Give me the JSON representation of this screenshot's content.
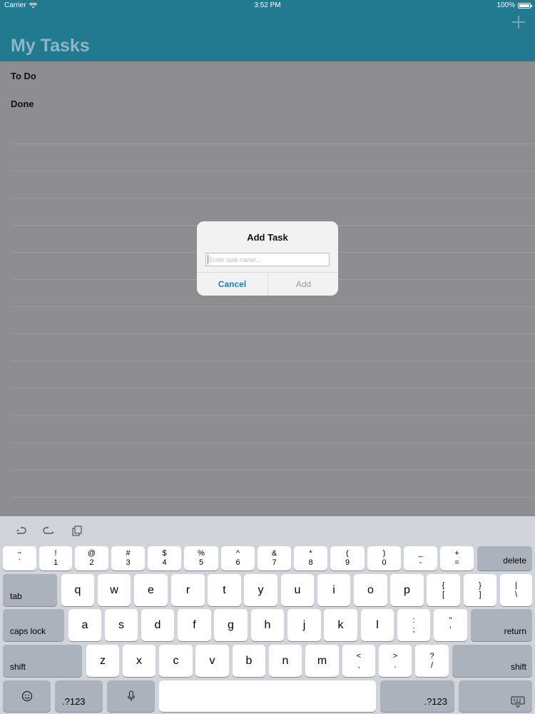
{
  "status_bar": {
    "carrier": "Carrier",
    "time": "3:52 PM",
    "battery": "100%"
  },
  "nav": {
    "title": "My Tasks",
    "add_icon": "plus-icon"
  },
  "sections": {
    "todo": "To Do",
    "done": "Done"
  },
  "alert": {
    "title": "Add Task",
    "placeholder": "Enter task name...",
    "cancel": "Cancel",
    "add": "Add"
  },
  "keyboard": {
    "toolbar": [
      "undo-icon",
      "redo-icon",
      "paste-icon"
    ],
    "row1": [
      {
        "top": "~",
        "bottom": "`"
      },
      {
        "top": "!",
        "bottom": "1"
      },
      {
        "top": "@",
        "bottom": "2"
      },
      {
        "top": "#",
        "bottom": "3"
      },
      {
        "top": "$",
        "bottom": "4"
      },
      {
        "top": "%",
        "bottom": "5"
      },
      {
        "top": "^",
        "bottom": "6"
      },
      {
        "top": "&",
        "bottom": "7"
      },
      {
        "top": "*",
        "bottom": "8"
      },
      {
        "top": "(",
        "bottom": "9"
      },
      {
        "top": ")",
        "bottom": "0"
      },
      {
        "top": "_",
        "bottom": "-"
      },
      {
        "top": "+",
        "bottom": "="
      }
    ],
    "delete": "delete",
    "tab": "tab",
    "row2": [
      "q",
      "w",
      "e",
      "r",
      "t",
      "y",
      "u",
      "i",
      "o",
      "p"
    ],
    "row2_symbols": [
      {
        "top": "{",
        "bottom": "["
      },
      {
        "top": "}",
        "bottom": "]"
      },
      {
        "top": "|",
        "bottom": "\\"
      }
    ],
    "caps_lock": "caps lock",
    "row3": [
      "a",
      "s",
      "d",
      "f",
      "g",
      "h",
      "j",
      "k",
      "l"
    ],
    "row3_symbols": [
      {
        "top": ":",
        "bottom": ";"
      },
      {
        "top": "\"",
        "bottom": "'"
      }
    ],
    "return": "return",
    "shift": "shift",
    "row4": [
      "z",
      "x",
      "c",
      "v",
      "b",
      "n",
      "m"
    ],
    "row4_symbols": [
      {
        "top": "<",
        "bottom": ","
      },
      {
        "top": ">",
        "bottom": "."
      },
      {
        "top": "?",
        "bottom": "/"
      }
    ],
    "numbers": ".?123",
    "emoji_icon": "emoji-icon",
    "mic_icon": "microphone-icon",
    "dismiss_icon": "keyboard-dismiss-icon"
  }
}
